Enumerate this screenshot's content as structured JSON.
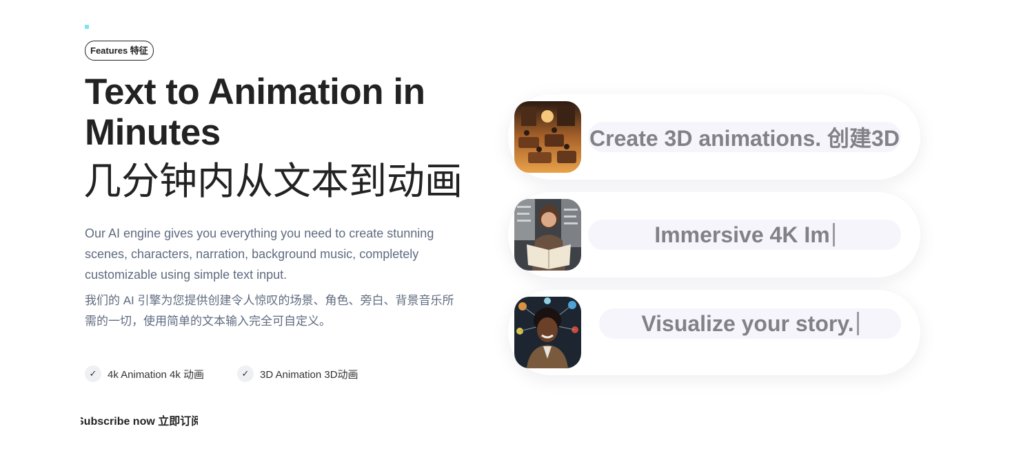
{
  "badge": {
    "label": "Features 特征"
  },
  "hero": {
    "title_en": "Text to Animation in Minutes",
    "title_zh": "几分钟内从文本到动画",
    "description_en": "Our AI engine gives you everything you need to create stunning scenes, characters, narration, background music, completely customizable using simple text input.",
    "description_zh": "我们的 AI 引擎为您提供创建令人惊叹的场景、角色、旁白、背景音乐所需的一切，使用简单的文本输入完全可自定义。"
  },
  "features": [
    {
      "label": "4k Animation 4k 动画",
      "icon": "check-icon"
    },
    {
      "label": "3D Animation  3D动画",
      "icon": "check-icon"
    }
  ],
  "subscribe": {
    "label": "Subscribe now 立即订阅"
  },
  "cards": [
    {
      "text": "Create 3D animations. 创建3D",
      "image": "3d-animated-scene-thumbnail"
    },
    {
      "text": "Immersive 4K Im",
      "image": "woman-reading-book-thumbnail"
    },
    {
      "text": "Visualize your story.",
      "image": "man-with-network-thumbnail"
    }
  ],
  "colors": {
    "accent": "#7ee3f4",
    "heading": "#222222",
    "body_text": "#5f6b80",
    "pill_bg": "#f5f5fb",
    "pill_text": "#818187"
  }
}
